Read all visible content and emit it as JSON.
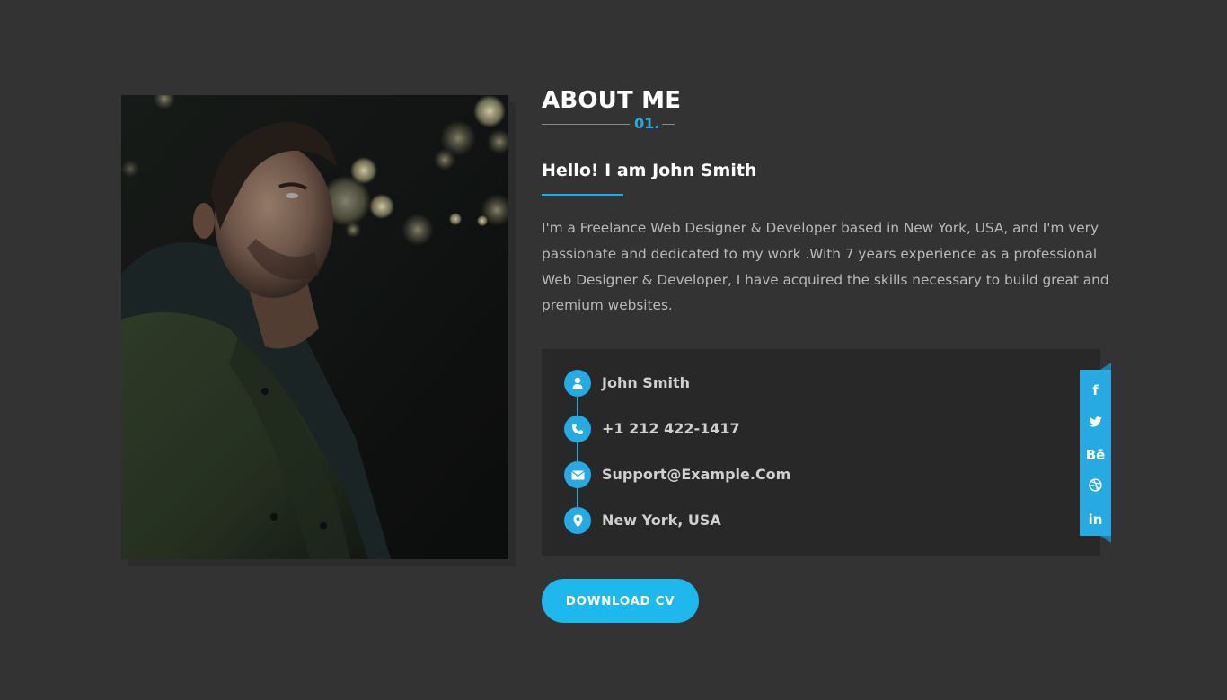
{
  "about": {
    "title": "ABOUT ME",
    "number": "01."
  },
  "intro": {
    "heading": "Hello! I am John Smith",
    "bio": "I'm a Freelance Web Designer & Developer based in New York, USA, and I'm very passionate and dedicated to my work .With 7 years experience as a professional Web Designer & Developer, I have acquired the skills necessary to build great and premium websites."
  },
  "contact": {
    "items": [
      {
        "icon": "user-icon",
        "text": "John Smith"
      },
      {
        "icon": "phone-icon",
        "text": "+1 212 422-1417"
      },
      {
        "icon": "envelope-icon",
        "text": "Support@Example.Com"
      },
      {
        "icon": "map-marker-icon",
        "text": "New York, USA"
      }
    ]
  },
  "social": {
    "items": [
      {
        "icon": "facebook-icon",
        "glyph": "f"
      },
      {
        "icon": "twitter-icon",
        "glyph": ""
      },
      {
        "icon": "behance-icon",
        "glyph": "Bē"
      },
      {
        "icon": "dribbble-icon",
        "glyph": ""
      },
      {
        "icon": "linkedin-icon",
        "glyph": "in"
      }
    ]
  },
  "buttons": {
    "download_cv": "DOWNLOAD CV"
  },
  "colors": {
    "accent": "#27a9e1",
    "background": "#333333",
    "card": "#282828"
  }
}
